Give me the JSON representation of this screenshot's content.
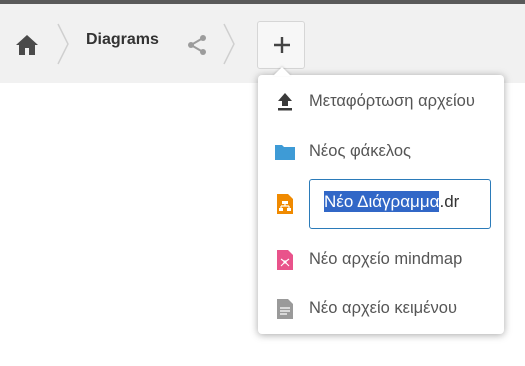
{
  "breadcrumb": {
    "home_icon": "home-icon",
    "current": "Diagrams",
    "share_icon": "share-icon"
  },
  "new_button": {
    "icon": "plus-icon"
  },
  "new_menu": {
    "items": [
      {
        "label": "Μεταφόρτωση αρχείου",
        "icon": "upload-icon"
      },
      {
        "label": "Νέος φάκελος",
        "icon": "folder-icon",
        "color": "#3e9bd6"
      },
      {
        "label": "Νέο αρχείο mindmap",
        "icon": "mindmap-file-icon",
        "color": "#e9538b"
      },
      {
        "label": "Νέο αρχείο κειμένου",
        "icon": "text-file-icon",
        "color": "#9a9a9a"
      }
    ],
    "diagram_item": {
      "icon": "diagram-file-icon",
      "color": "#f08a00",
      "filename_selected": "Νέο Διάγραμμα",
      "filename_extension": ".dr"
    }
  },
  "colors": {
    "accent": "#3167c7",
    "breadcrumb_bg": "#f1f1f1"
  }
}
